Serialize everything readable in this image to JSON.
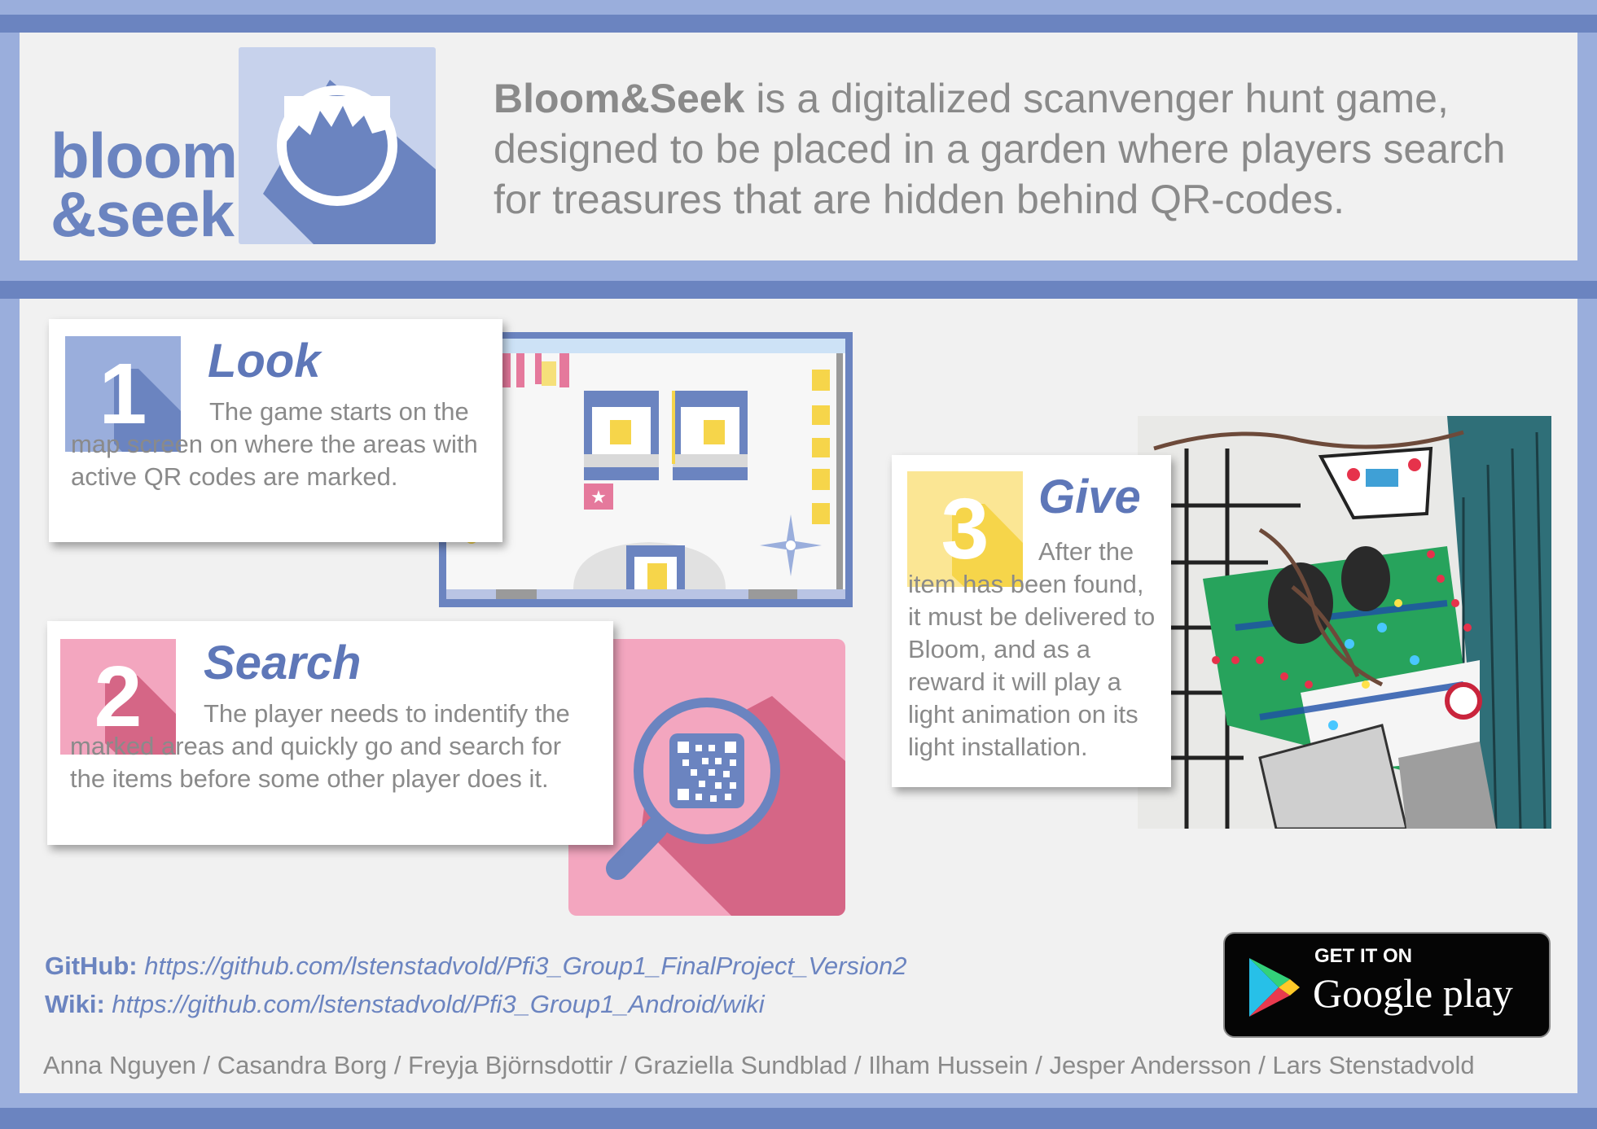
{
  "header": {
    "logo": {
      "line1": "bloom",
      "line2": "&seek"
    },
    "intro_bold": "Bloom&Seek",
    "intro_rest": " is a digitalized scanvenger hunt game, designed to be placed in a garden where players search for treasures that are hidden behind QR-codes."
  },
  "steps": [
    {
      "number": "1",
      "title": "Look",
      "text": "The game starts on the map screen on where the areas with active QR codes are marked."
    },
    {
      "number": "2",
      "title": "Search",
      "text": "The player needs to indentify the marked areas and quickly go and search for the items before some other player does it."
    },
    {
      "number": "3",
      "title": "Give",
      "text": "After the item has been found, it must be delivered to Bloom, and as a reward it will play a light animation on its light installation."
    }
  ],
  "links": {
    "github_label": "GitHub:",
    "github_url": "https://github.com/lstenstadvold/Pfi3_Group1_FinalProject_Version2",
    "wiki_label": "Wiki:",
    "wiki_url": "https://github.com/lstenstadvold/Pfi3_Group1_Android/wiki"
  },
  "authors": "Anna Nguyen / Casandra Borg / Freyja Björnsdottir / Graziella Sundblad / Ilham Hussein / Jesper Andersson / Lars Stenstadvold",
  "store_badge": {
    "top": "GET IT ON",
    "bottom": "Google play",
    "icon": "play-store-icon"
  },
  "colors": {
    "accent_blue": "#6b84c0",
    "pink": "#e5799c",
    "yellow": "#f6d54a",
    "text_gray": "#8a8a8a"
  }
}
